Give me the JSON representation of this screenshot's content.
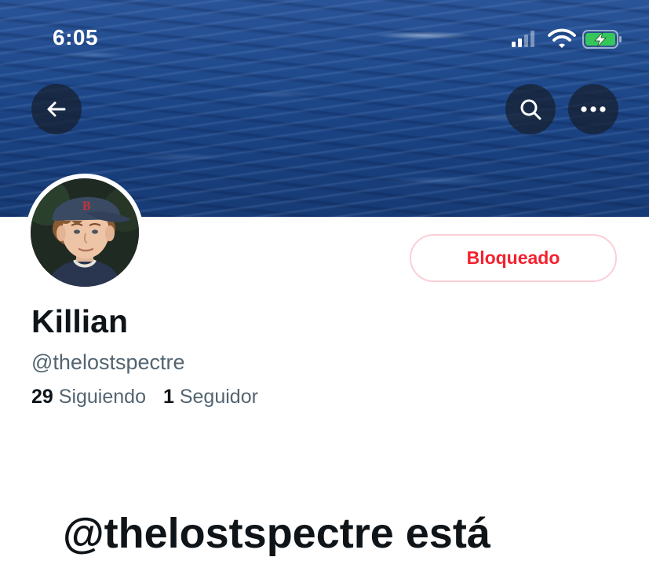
{
  "status_bar": {
    "time": "6:05",
    "icons": [
      "cellular-signal-icon",
      "wifi-icon",
      "battery-charging-icon"
    ]
  },
  "banner": {
    "description_icon": "ocean-header-image"
  },
  "nav": {
    "back_icon": "arrow-left-icon",
    "search_icon": "search-icon",
    "more_icon": "more-horizontal-icon"
  },
  "profile": {
    "name": "Killian",
    "handle": "@thelostspectre",
    "following_count": "29",
    "following_label": "Siguiendo",
    "followers_count": "1",
    "followers_label": "Seguidor",
    "blocked_button_label": "Bloqueado",
    "blocked_message": "@thelostspectre está"
  },
  "colors": {
    "accent_red": "#f4212e",
    "blocked_border": "#fbcfd6",
    "secondary_text": "#536471",
    "primary_text": "#0f1419"
  }
}
